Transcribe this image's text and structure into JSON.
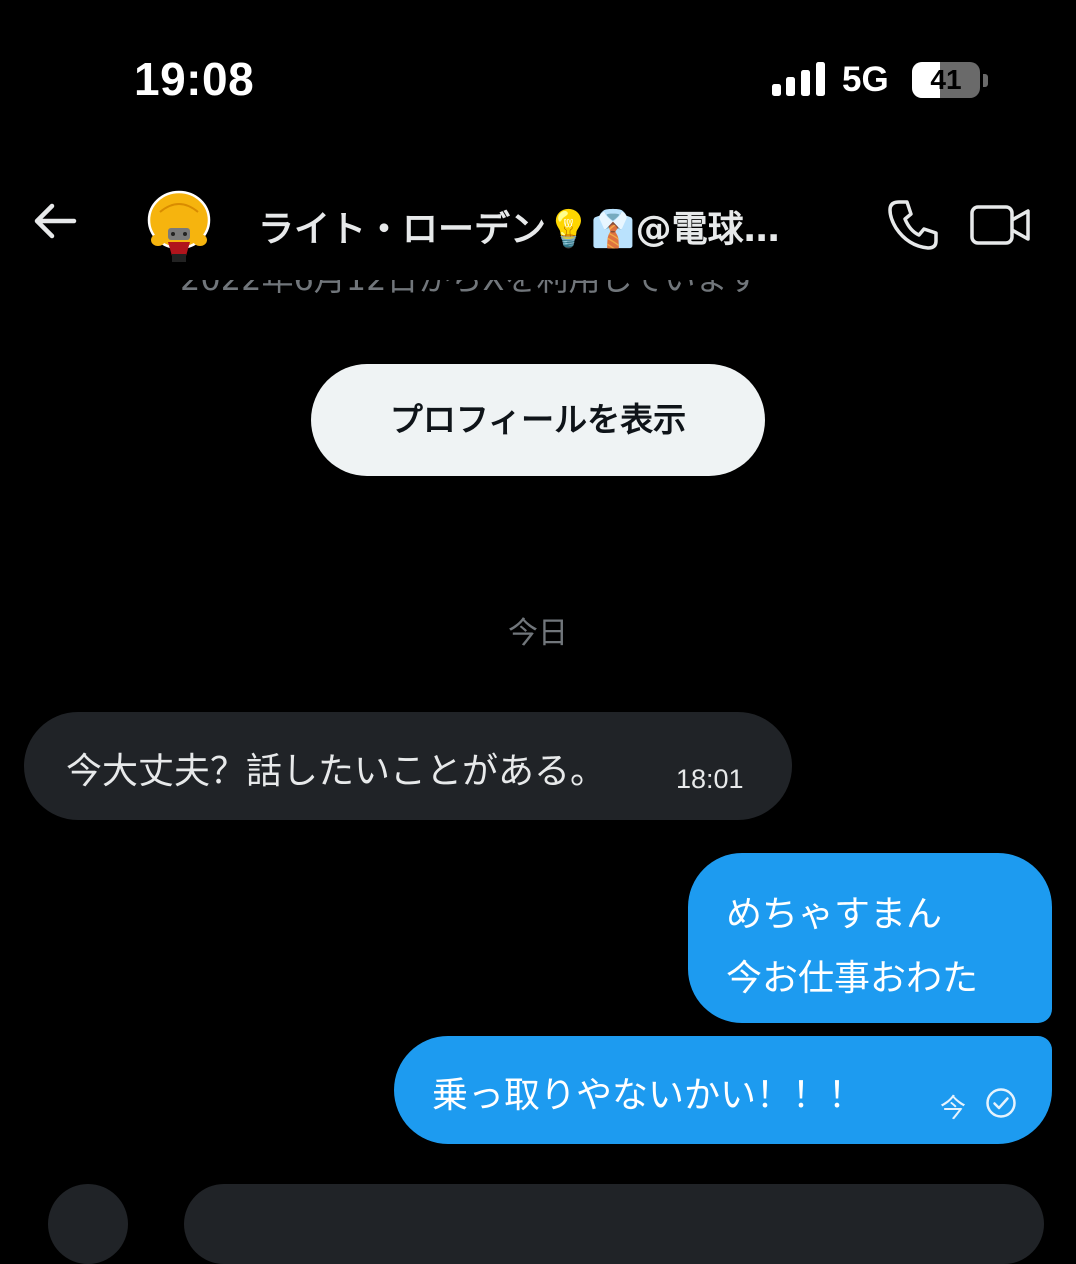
{
  "status_bar": {
    "time": "19:08",
    "network": "5G",
    "battery": "41",
    "battery_level": 0.41
  },
  "header": {
    "contact_name": "ライト・ローデン💡👔@電球…"
  },
  "conversation_info": {
    "joined_text_partial": "2022年6月12日からXを利用しています"
  },
  "profile_button": {
    "label": "プロフィールを表示"
  },
  "date_divider": "今日",
  "messages": [
    {
      "direction": "received",
      "text": "今大丈夫？話したいことがある。",
      "time": "18:01"
    },
    {
      "direction": "sent",
      "lines": [
        "めちゃすまん",
        "今お仕事おわた"
      ]
    },
    {
      "direction": "sent",
      "text": "乗っ取りやないかい！！！",
      "time": "今",
      "status_icon": "read-check-icon"
    }
  ],
  "colors": {
    "background": "#000000",
    "sent_bubble": "#1d9bf0",
    "received_bubble": "#202327",
    "muted_text": "#71767b"
  }
}
